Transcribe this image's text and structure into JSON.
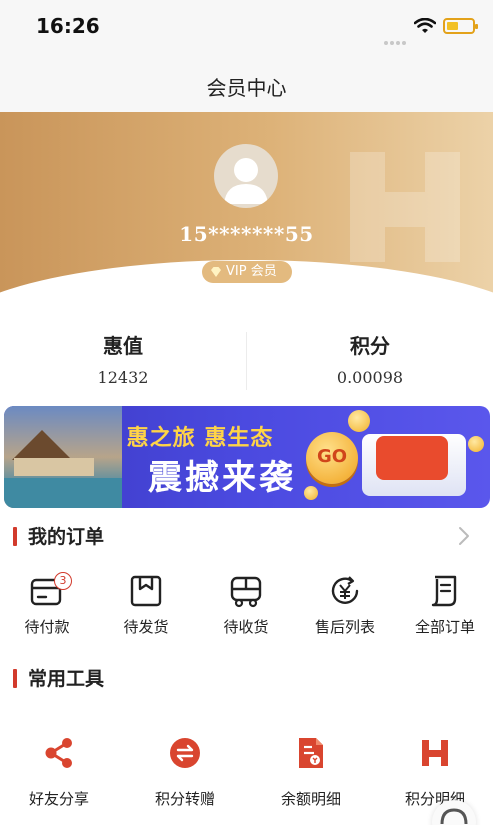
{
  "status_bar": {
    "time": "16:26"
  },
  "header": {
    "title": "会员中心"
  },
  "profile": {
    "phone": "15*******55",
    "vip_label": "VIP 会员"
  },
  "stats": [
    {
      "label": "惠值",
      "value": "12432"
    },
    {
      "label": "积分",
      "value": "0.00098"
    }
  ],
  "banner": {
    "subtitle": "惠之旅  惠生态",
    "title": "震撼来袭",
    "go_label": "GO"
  },
  "orders": {
    "title": "我的订单",
    "items": [
      {
        "label": "待付款",
        "icon": "pending-payment-icon",
        "badge": "3"
      },
      {
        "label": "待发货",
        "icon": "pending-shipment-icon"
      },
      {
        "label": "待收货",
        "icon": "truck-icon"
      },
      {
        "label": "售后列表",
        "icon": "after-sales-icon"
      },
      {
        "label": "全部订单",
        "icon": "all-orders-icon"
      }
    ]
  },
  "tools": {
    "title": "常用工具",
    "items": [
      {
        "label": "好友分享",
        "icon": "share-icon"
      },
      {
        "label": "积分转赠",
        "icon": "points-transfer-icon"
      },
      {
        "label": "余额明细",
        "icon": "balance-detail-icon"
      },
      {
        "label": "积分明细",
        "icon": "points-detail-icon"
      }
    ]
  },
  "colors": {
    "accent": "#d23a2c",
    "gold": "#d9a866",
    "banner_blue": "#4645d8"
  }
}
